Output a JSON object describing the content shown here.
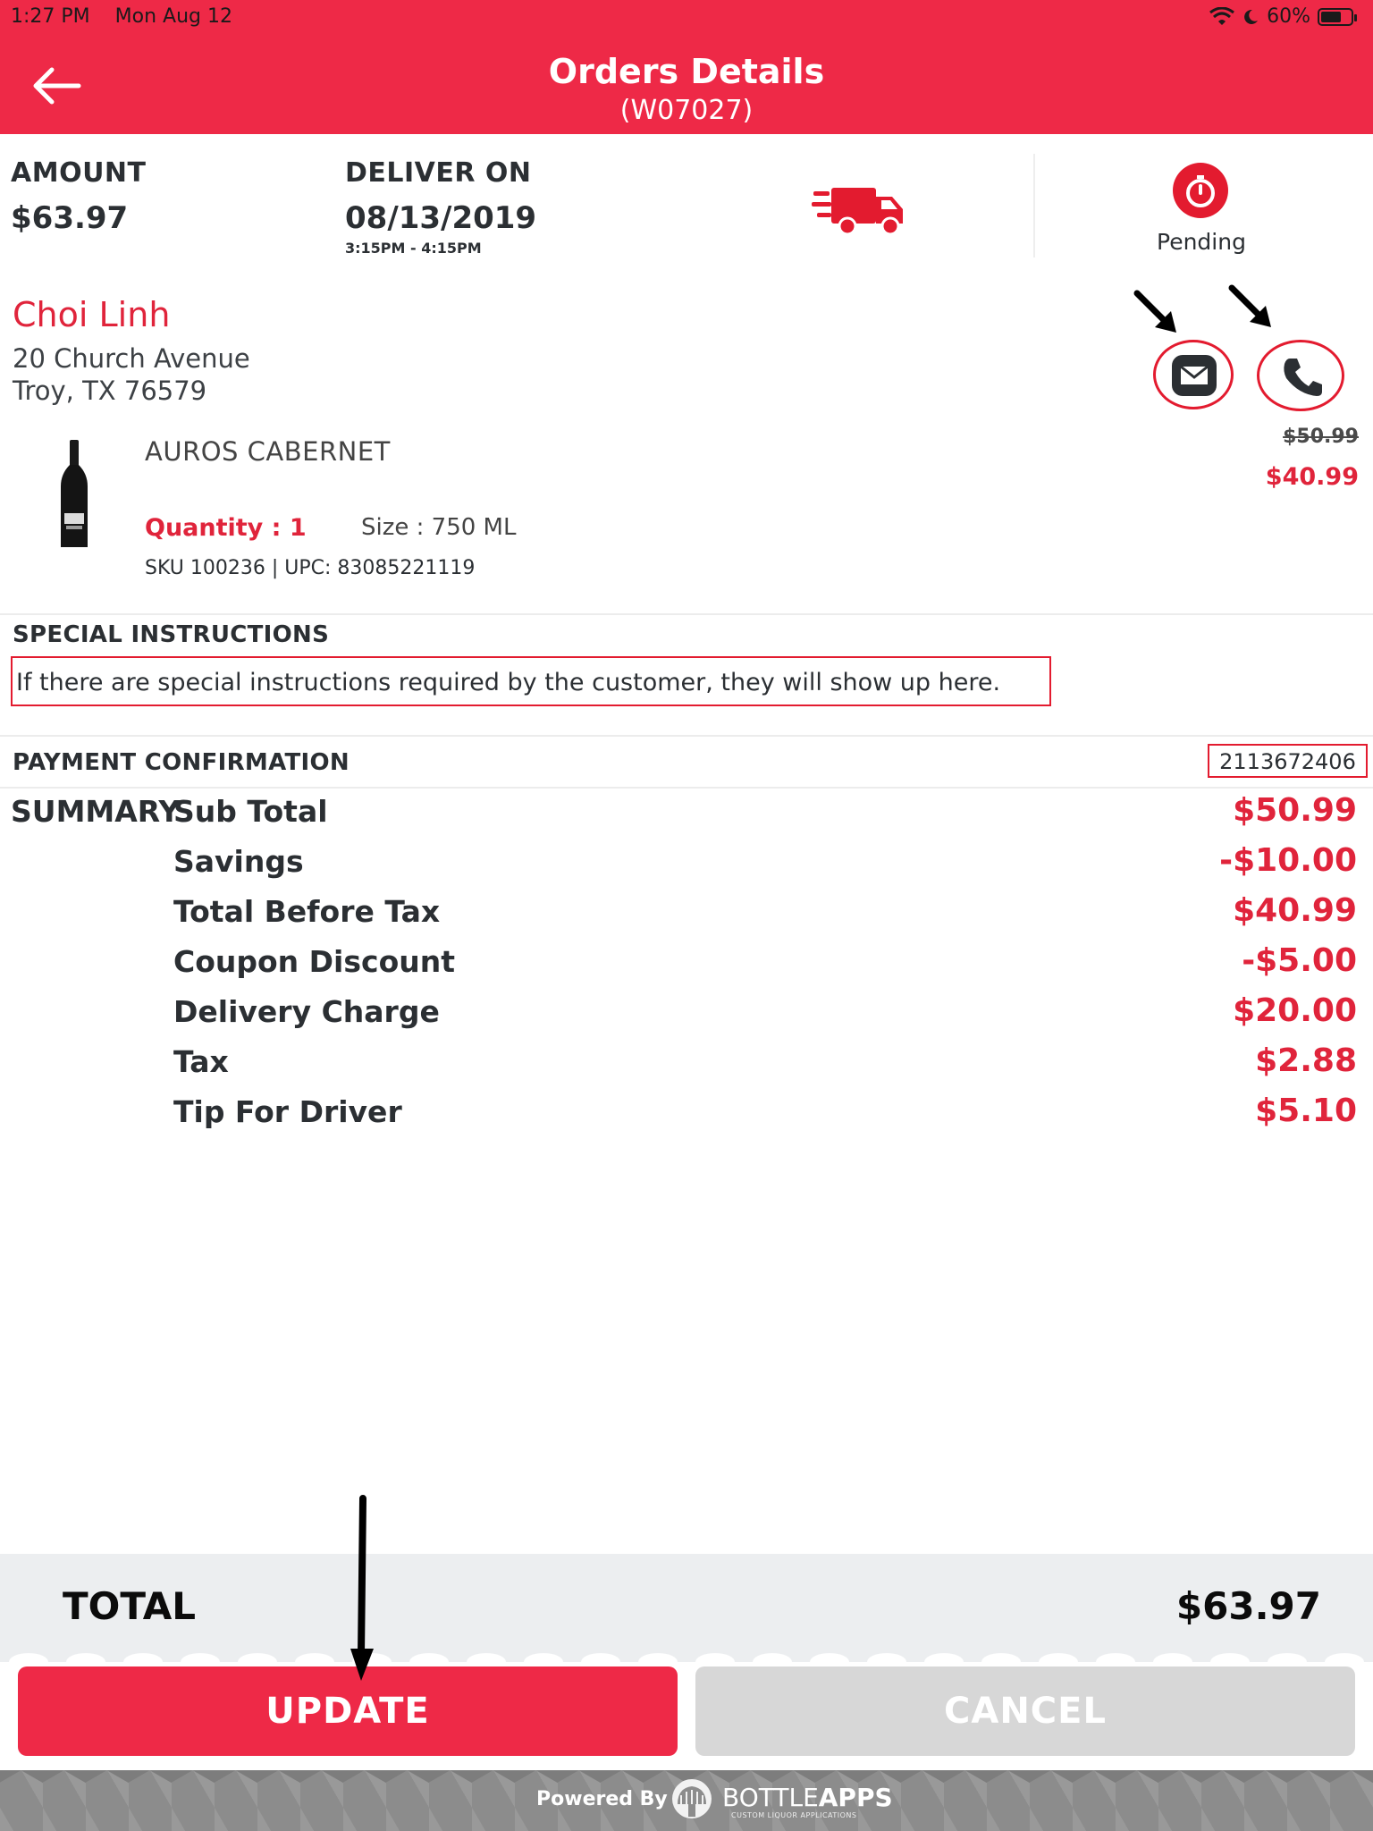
{
  "status_bar": {
    "time": "1:27 PM",
    "date": "Mon Aug 12",
    "battery": "60%"
  },
  "header": {
    "title": "Orders Details",
    "order_id": "(W07027)",
    "accent_color": "#ee2947"
  },
  "overview": {
    "amount_label": "AMOUNT",
    "amount_value": "$63.97",
    "deliver_label": "DELIVER ON",
    "deliver_date": "08/13/2019",
    "deliver_window": "3:15PM - 4:15PM",
    "delivery_icon": "delivery-truck-icon",
    "status_icon": "stopwatch-icon",
    "status": "Pending"
  },
  "customer": {
    "name": "Choi Linh",
    "address_line1": "20 Church Avenue",
    "address_line2": "Troy, TX 76579",
    "contact_icons": [
      "mail-icon",
      "phone-icon"
    ]
  },
  "item": {
    "name": "AUROS CABERNET",
    "quantity_label": "Quantity :  1",
    "size_label": "Size :  750 ML",
    "sku_upc": "SKU 100236 | UPC: 83085221119",
    "original_price": "$50.99",
    "sale_price": "$40.99"
  },
  "special_instructions": {
    "title": "SPECIAL INSTRUCTIONS",
    "text": "If there are special instructions required by the customer, they will show up here."
  },
  "payment": {
    "title": "PAYMENT CONFIRMATION",
    "confirmation": "2113672406"
  },
  "summary": {
    "title": "SUMMARY",
    "rows": [
      {
        "label": "Sub Total",
        "value": "$50.99"
      },
      {
        "label": "Savings",
        "value": "-$10.00"
      },
      {
        "label": "Total Before Tax",
        "value": "$40.99"
      },
      {
        "label": "Coupon Discount",
        "value": "-$5.00"
      },
      {
        "label": "Delivery Charge",
        "value": "$20.00"
      },
      {
        "label": "Tax",
        "value": "$2.88"
      },
      {
        "label": "Tip For Driver",
        "value": "$5.10"
      }
    ]
  },
  "total": {
    "label": "TOTAL",
    "value": "$63.97"
  },
  "actions": {
    "update_label": "UPDATE",
    "cancel_label": "CANCEL"
  },
  "footer": {
    "powered_by": "Powered By",
    "brand_light": "BOTTLE",
    "brand_bold": "APPS",
    "brand_tagline": "CUSTOM LIQUOR APPLICATIONS"
  }
}
